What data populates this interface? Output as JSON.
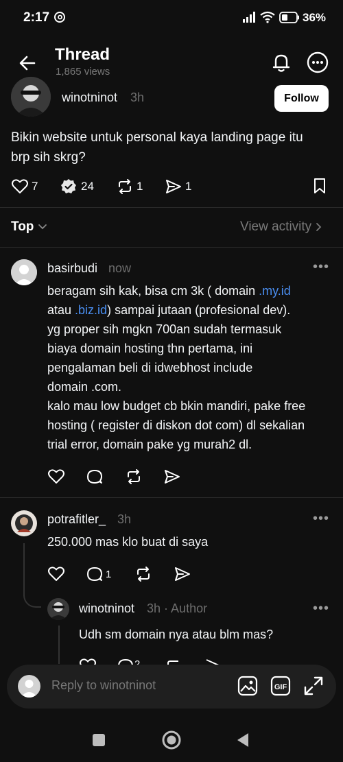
{
  "status_bar": {
    "time": "2:17",
    "battery": "36%"
  },
  "header": {
    "title": "Thread",
    "views": "1,865 views"
  },
  "post": {
    "username": "winotninot",
    "time": "3h",
    "follow_label": "Follow",
    "text_line1": "Bikin website untuk personal kaya landing page itu",
    "text_line2": "brp sih skrg?",
    "likes": "7",
    "replies": "24",
    "reposts": "1",
    "shares": "1"
  },
  "sort": {
    "label": "Top",
    "view_activity": "View activity"
  },
  "comments": [
    {
      "username": "basirbudi",
      "time": "now",
      "lines": [
        "yg proper sih mgkn 700an sudah termasuk",
        "biaya domain hosting thn pertama, ini",
        "pengalaman beli di idwebhost include",
        "domain .com.",
        "kalo mau low budget cb bkin mandiri, pake free",
        "hosting ( register di diskon dot com) dl sekalian",
        "trial error, domain pake yg murah2 dl."
      ],
      "line1_a": "beragam sih kak, bisa cm 3k ( domain ",
      "line1_link": ".my.id",
      "line2_a": "atau ",
      "line2_link": ".biz.id",
      "line2_b": ") sampai jutaan (profesional dev)."
    },
    {
      "username": "potrafitler_",
      "time": "3h",
      "text": "250.000 mas klo buat di saya",
      "replies": "1"
    },
    {
      "username": "winotninot",
      "time": "3h",
      "author_tag": "· Author",
      "text": "Udh sm domain nya atau blm mas?",
      "partial_count": "2"
    }
  ],
  "reply_bar": {
    "placeholder": "Reply to winotninot"
  }
}
